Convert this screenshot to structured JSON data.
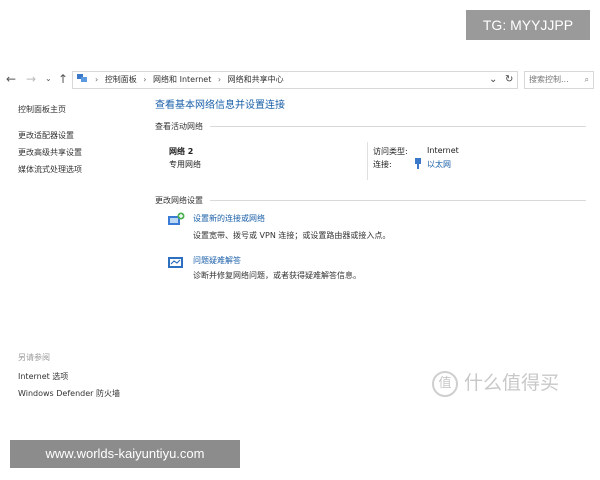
{
  "watermark_top": "TG: MYYJJPP",
  "watermark_bottom": "www.worlds-kaiyuntiyu.com",
  "logo_text": "什么值得买",
  "logo_badge": "值",
  "nav": {
    "back_icon": "arrow-left-icon",
    "forward_icon": "arrow-right-icon",
    "dropdown_icon": "chevron-down-icon",
    "up_icon": "arrow-up-icon",
    "breadcrumbs": [
      "控制面板",
      "网络和 Internet",
      "网络和共享中心"
    ],
    "refresh_icon": "refresh-icon",
    "search_placeholder": "搜索控制..."
  },
  "sidebar": {
    "items": [
      {
        "label": "控制面板主页"
      },
      {
        "label": "更改适配器设置"
      },
      {
        "label": "更改高级共享设置"
      },
      {
        "label": "媒体流式处理选项"
      }
    ],
    "see_also_title": "另请参阅",
    "see_also": [
      {
        "label": "Internet 选项"
      },
      {
        "label": "Windows Defender 防火墙"
      }
    ]
  },
  "main": {
    "heading": "查看基本网络信息并设置连接",
    "active_networks_title": "查看活动网络",
    "network": {
      "name": "网络 2",
      "type": "专用网络",
      "access_label": "访问类型:",
      "access_value": "Internet",
      "connection_label": "连接:",
      "connection_value": "以太网"
    },
    "change_settings_title": "更改网络设置",
    "actions": [
      {
        "link": "设置新的连接或网络",
        "desc": "设置宽带、拨号或 VPN 连接；或设置路由器或接入点。"
      },
      {
        "link": "问题疑难解答",
        "desc": "诊断并修复网络问题，或者获得疑难解答信息。"
      }
    ]
  }
}
